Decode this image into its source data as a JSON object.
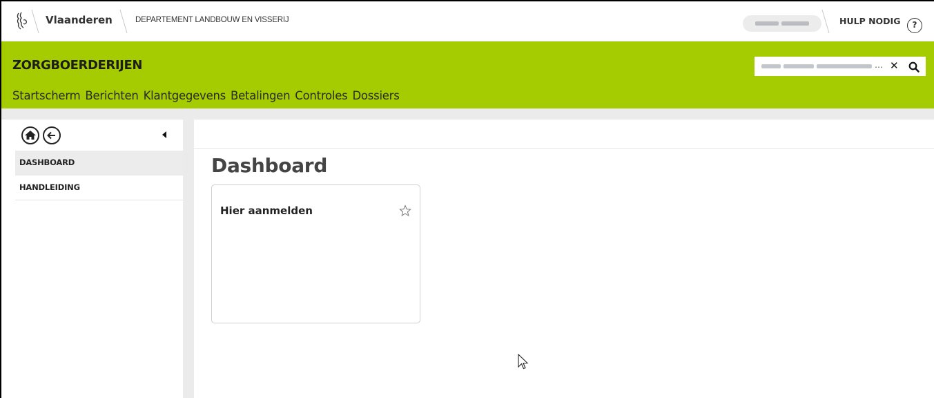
{
  "header": {
    "brand": "Vlaanderen",
    "department": "DEPARTEMENT LANDBOUW EN VISSERIJ",
    "help_label": "HULP NODIG",
    "help_icon_glyph": "?"
  },
  "app": {
    "title": "ZORGBOERDERIJEN",
    "accent_color": "#a4cc00",
    "search": {
      "value_redacted": true,
      "ellipsis": "…",
      "clear_glyph": "✕"
    },
    "nav": [
      {
        "label": "Startscherm"
      },
      {
        "label": "Berichten"
      },
      {
        "label": "Klantgegevens"
      },
      {
        "label": "Betalingen"
      },
      {
        "label": "Controles"
      },
      {
        "label": "Dossiers"
      }
    ]
  },
  "sidebar": {
    "items": [
      {
        "label": "DASHBOARD",
        "active": true
      },
      {
        "label": "HANDLEIDING",
        "active": false
      }
    ]
  },
  "main": {
    "title": "Dashboard",
    "cards": [
      {
        "title": "Hier aanmelden",
        "starred": false
      }
    ]
  },
  "icons": [
    "lion-logo-icon",
    "help-icon",
    "clear-icon",
    "search-icon",
    "home-icon",
    "back-arrow-icon",
    "collapse-left-icon",
    "star-outline-icon",
    "mouse-cursor-icon"
  ]
}
